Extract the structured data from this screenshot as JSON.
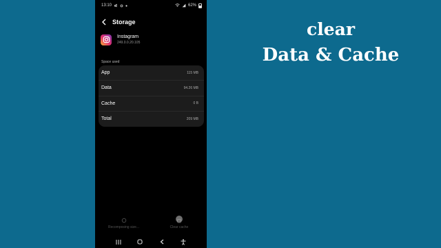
{
  "status_bar": {
    "time": "13:10",
    "battery": "62%"
  },
  "screen": {
    "title": "Storage"
  },
  "app": {
    "name": "Instagram",
    "version": "249.0.0.20.105"
  },
  "storage": {
    "section_header": "Space used",
    "rows": [
      {
        "label": "App",
        "value": "115 MB"
      },
      {
        "label": "Data",
        "value": "94.26 MB"
      },
      {
        "label": "Cache",
        "value": "0 B"
      },
      {
        "label": "Total",
        "value": "209 MB"
      }
    ]
  },
  "actions": {
    "recompose_label": "Recomposing size...",
    "clear_cache_label": "Clear cache"
  },
  "overlay": {
    "line1": "clear",
    "line2": "Data & Cache"
  },
  "colors": {
    "background": "#0d6a8e",
    "phone_background": "#000000",
    "card_background": "#1c1c1c"
  }
}
